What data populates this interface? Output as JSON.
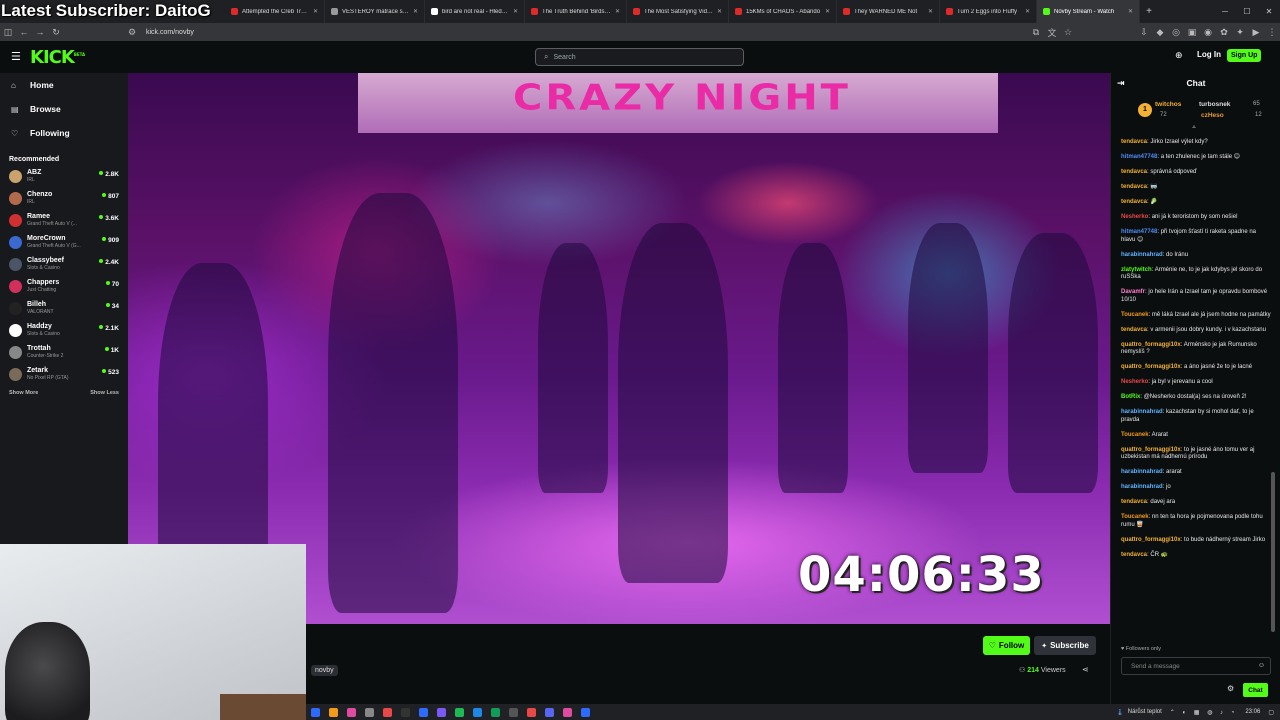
{
  "overlay": {
    "latest_subscriber": "Latest Subscriber: DaitoG"
  },
  "browser": {
    "tabs": [
      {
        "title": "Attempted the Creb Track. |"
      },
      {
        "title": "VESTERÖY matrace s taštičk"
      },
      {
        "title": "bird are not real - Hledat G"
      },
      {
        "title": "The Truth Behind 'Birds Aren"
      },
      {
        "title": "The Most Satisfying Videos"
      },
      {
        "title": "15KMs of CHAOS - Abando"
      },
      {
        "title": "They WARNED ME Not"
      },
      {
        "title": "Turn 2 Eggs into Fluffy"
      },
      {
        "title": "Novby Stream - Watch"
      }
    ],
    "url": "kick.com/novby"
  },
  "header": {
    "logo": "KICK",
    "logo_sup": "BETA",
    "search_placeholder": "Search",
    "login": "Log In",
    "signup": "Sign Up"
  },
  "sidebar": {
    "nav": [
      {
        "label": "Home"
      },
      {
        "label": "Browse"
      },
      {
        "label": "Following"
      }
    ],
    "recommended_title": "Recommended",
    "recommended": [
      {
        "name": "ABZ",
        "category": "IRL",
        "viewers": "2.8K",
        "color": "#c9a36b"
      },
      {
        "name": "Chenzo",
        "category": "IRL",
        "viewers": "807",
        "color": "#b36a4a"
      },
      {
        "name": "Ramee",
        "category": "Grand Theft Auto V (...",
        "viewers": "3.6K",
        "color": "#d03030"
      },
      {
        "name": "MoreCrown",
        "category": "Grand Theft Auto V (G...",
        "viewers": "909",
        "color": "#3a6ad0"
      },
      {
        "name": "Classybeef",
        "category": "Slots & Casino",
        "viewers": "2.4K",
        "color": "#4c5568"
      },
      {
        "name": "Chappers",
        "category": "Just Chatting",
        "viewers": "70",
        "color": "#d0305a"
      },
      {
        "name": "Billeh",
        "category": "VALORANT",
        "viewers": "34",
        "color": "#222222"
      },
      {
        "name": "Haddzy",
        "category": "Slots & Casino",
        "viewers": "2.1K",
        "color": "#ffffff"
      },
      {
        "name": "Trottah",
        "category": "Counter-Strike 2",
        "viewers": "1K",
        "color": "#888888"
      },
      {
        "name": "Zetark",
        "category": "No Pixel RP (GTA)",
        "viewers": "523",
        "color": "#7a6a5a"
      }
    ],
    "show_more": "Show More",
    "show_less": "Show Less"
  },
  "video": {
    "sign": "CRAZY NIGHT",
    "timer": "04:06:33"
  },
  "stream": {
    "channel": "novby",
    "follow": "Follow",
    "subscribe": "Subscribe",
    "viewers_count": "214",
    "viewers_label": "Viewers"
  },
  "chat": {
    "title": "Chat",
    "pinned": {
      "first": "twitchos",
      "first_count": "72",
      "second": "turbosnek",
      "second_count": "65",
      "third": "czHeso",
      "third_count": "12"
    },
    "messages": [
      {
        "user": "tendavca",
        "text": "Jirko Izrael výlet kdy?",
        "color": "#f2b134"
      },
      {
        "user": "hitman47748",
        "text": "a ten zhulenec je tam stále 😊",
        "color": "#4f8df5"
      },
      {
        "user": "tendavca",
        "text": "správná odpoveď",
        "color": "#f2b134"
      },
      {
        "user": "tendavca",
        "text": "🥽",
        "color": "#f2b134"
      },
      {
        "user": "tendavca",
        "text": "🥬",
        "color": "#f2b134"
      },
      {
        "user": "Nesherko",
        "text": "ani já k teroristom by som nešiel",
        "color": "#e84848"
      },
      {
        "user": "hitman47748",
        "text": "při tvojom šťastí ti raketa spadne na hlavu 😊",
        "color": "#4f8df5"
      },
      {
        "user": "harabinnahrad",
        "text": "do Iránu",
        "color": "#5fb3ff"
      },
      {
        "user": "zlatytwitch",
        "text": "Arménie ne, to je jak kdybys jel skoro do ruSSka",
        "color": "#53fc18"
      },
      {
        "user": "Davamfr",
        "text": "jo hele Irán a Izrael tam je opravdu bombové 10/10",
        "color": "#ff7fd0"
      },
      {
        "user": "Toucanek",
        "text": "mě láká Izrael ale já jsem hodne na památky",
        "color": "#f29a1a"
      },
      {
        "user": "tendavca",
        "text": "v armenii jsou dobry kundy. i v kazachstanu",
        "color": "#f2b134"
      },
      {
        "user": "quattro_formaggi10x",
        "text": "Arménsko je jak Rumunsko nemyslíš ?",
        "color": "#f2b134"
      },
      {
        "user": "quattro_formaggi10x",
        "text": "a áno jasné že to je lacné",
        "color": "#f2b134"
      },
      {
        "user": "Nesherko",
        "text": "ja byl v jerevanu a cool",
        "color": "#e84848"
      },
      {
        "user": "BotRix",
        "text": "@Nesherko dostal(a) ses na úroveň 2!",
        "color": "#53fc18"
      },
      {
        "user": "harabinnahrad",
        "text": "kazachstan by si mohol dať, to je pravda",
        "color": "#5fb3ff"
      },
      {
        "user": "Toucanek",
        "text": "Ararat",
        "color": "#f29a1a"
      },
      {
        "user": "quattro_formaggi10x",
        "text": "to je jasné áno tomu ver aj uzbekistan má nádhernú prírodu",
        "color": "#f2b134"
      },
      {
        "user": "harabinnahrad",
        "text": "ararat",
        "color": "#5fb3ff"
      },
      {
        "user": "harabinnahrad",
        "text": "jo",
        "color": "#5fb3ff"
      },
      {
        "user": "tendavca",
        "text": "davej ara",
        "color": "#f2b134"
      },
      {
        "user": "Toucanek",
        "text": "nn ten ta hora je pojmenovana podle tohu rumu 🥃",
        "color": "#f29a1a"
      },
      {
        "user": "quattro_formaggi10x",
        "text": "to bude nádherný stream Jirko",
        "color": "#f2b134"
      },
      {
        "user": "tendavca",
        "text": "ČR 🐢",
        "color": "#f2b134"
      }
    ],
    "followers_only": "Followers only",
    "placeholder": "Send a message",
    "send": "Chat"
  },
  "taskbar": {
    "weather": "Nárůst teplot",
    "time": "23:06"
  },
  "colors": {
    "accent": "#53fc18"
  }
}
